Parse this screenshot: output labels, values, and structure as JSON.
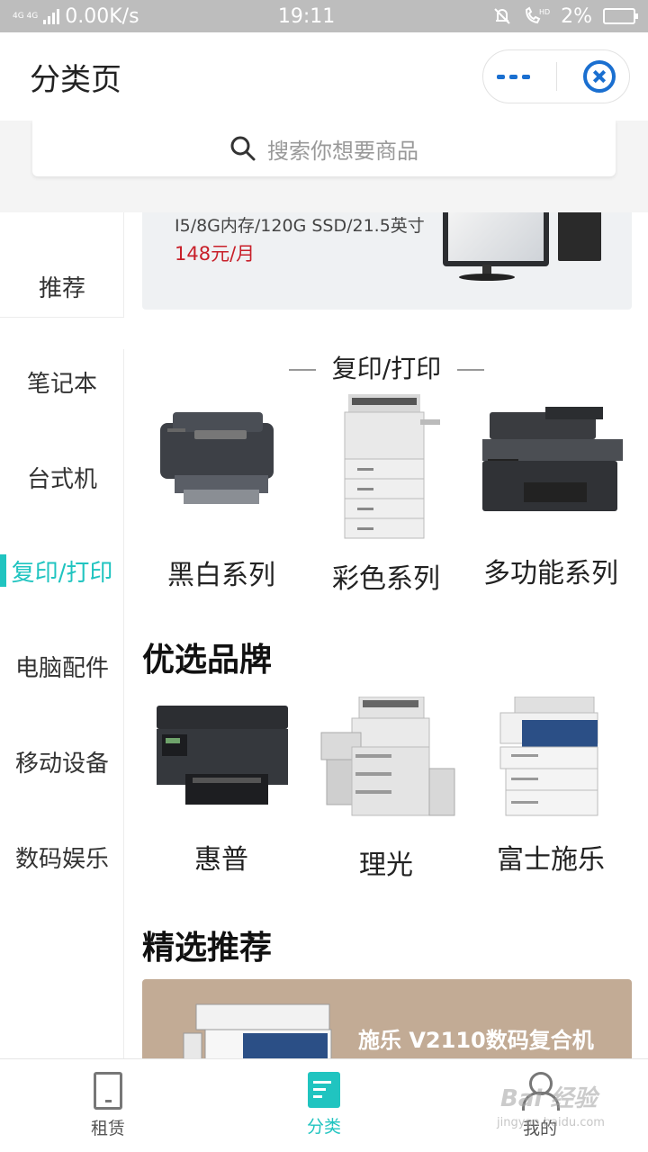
{
  "status_bar": {
    "network": "4G 4G",
    "speed": "0.00K/s",
    "time": "19:11",
    "battery": "2%"
  },
  "header": {
    "title": "分类页"
  },
  "search": {
    "placeholder": "搜索你想要商品"
  },
  "sidebar": {
    "items": [
      {
        "label": "推荐"
      },
      {
        "label": "笔记本"
      },
      {
        "label": "台式机"
      },
      {
        "label": "复印/打印"
      },
      {
        "label": "电脑配件"
      },
      {
        "label": "移动设备"
      },
      {
        "label": "数码娱乐"
      }
    ],
    "active_index": 3
  },
  "banner": {
    "spec": "I5/8G内存/120G SSD/21.5英寸",
    "price": "148元/月"
  },
  "category_section": {
    "title": "复印/打印",
    "items": [
      {
        "label": "黑白系列",
        "icon": "mono-printer-icon"
      },
      {
        "label": "彩色系列",
        "icon": "color-copier-icon"
      },
      {
        "label": "多功能系列",
        "icon": "mfp-printer-icon"
      }
    ]
  },
  "brands_section": {
    "title": "优选品牌",
    "items": [
      {
        "label": "惠普",
        "icon": "hp-printer-icon"
      },
      {
        "label": "理光",
        "icon": "ricoh-copier-icon"
      },
      {
        "label": "富士施乐",
        "icon": "fuji-xerox-copier-icon"
      }
    ]
  },
  "featured_section": {
    "title": "精选推荐",
    "promo_title": "施乐 V2110数码复合机"
  },
  "tabbar": {
    "tabs": [
      {
        "label": "租赁",
        "icon": "rent-icon"
      },
      {
        "label": "分类",
        "icon": "category-icon"
      },
      {
        "label": "我的",
        "icon": "user-icon"
      }
    ],
    "active_index": 1
  },
  "watermark": {
    "text": "Bai 经验",
    "sub": "jingyan.baidu.com"
  },
  "colors": {
    "accent": "#20c4c0",
    "price": "#c8202a",
    "brand_blue": "#1a6fd0",
    "promo_bg": "#c2ab95"
  }
}
